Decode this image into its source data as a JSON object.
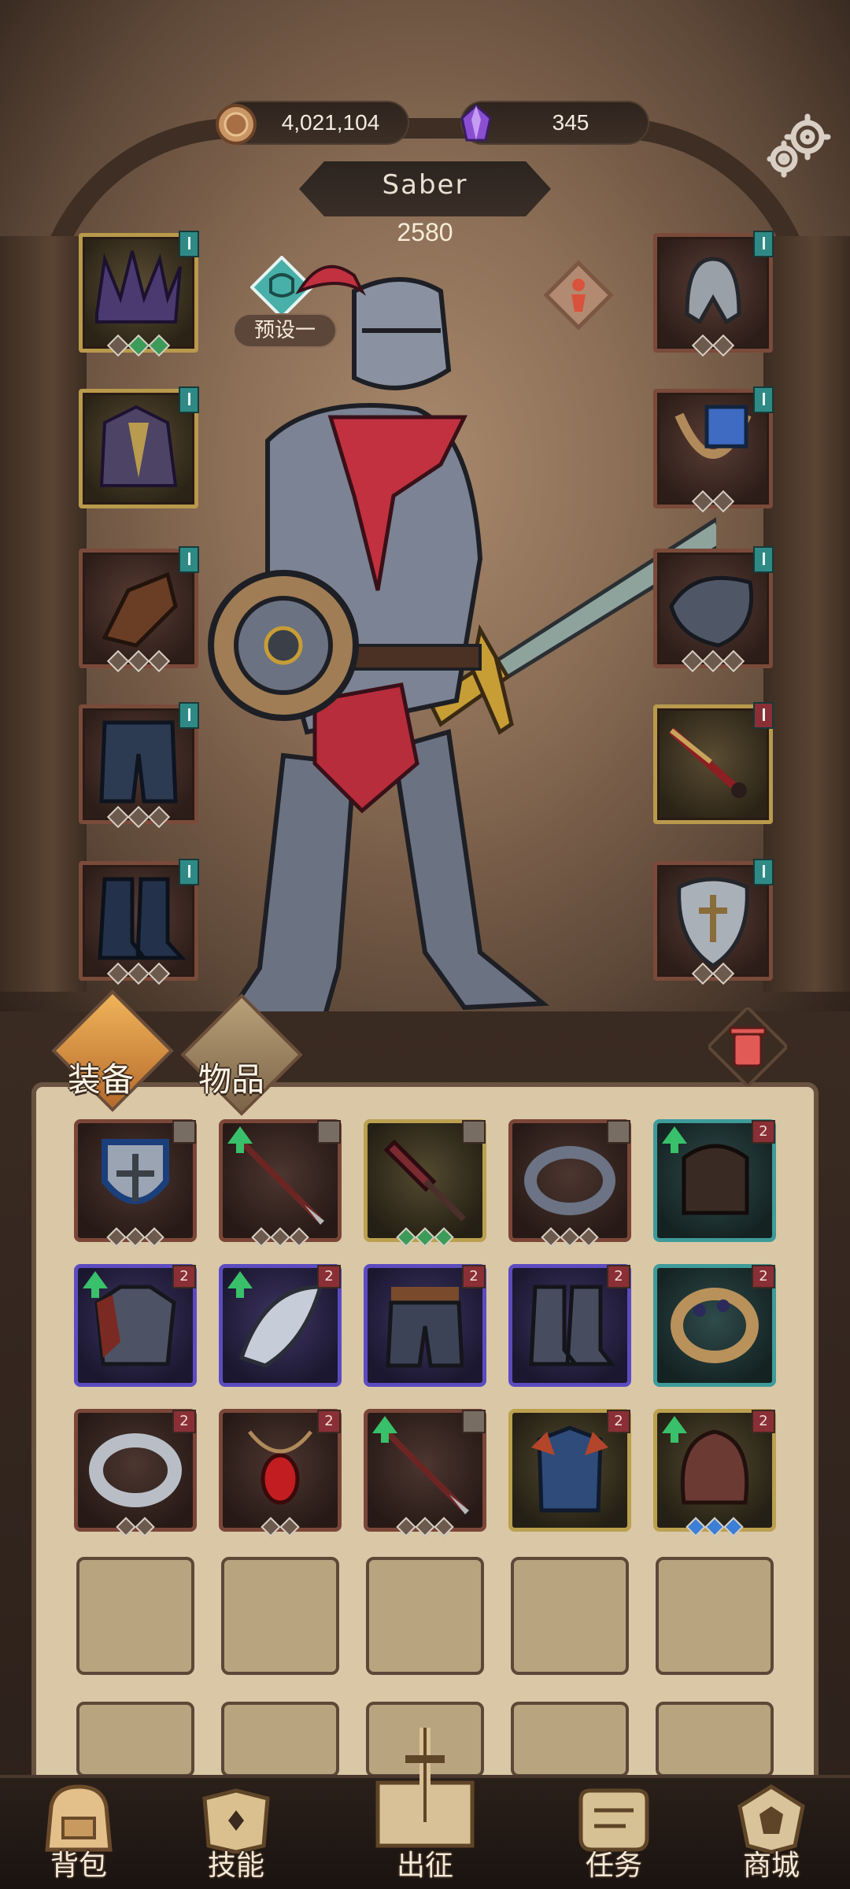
{
  "currency": {
    "coins": "4,021,104",
    "gems": "345"
  },
  "icons": {
    "coin": "coin-icon",
    "gem": "purple-crystal-icon",
    "settings": "gear-icon",
    "trash": "trash-icon"
  },
  "character": {
    "name": "Saber",
    "power": "2580"
  },
  "preset": {
    "label": "预设一"
  },
  "tabs": {
    "equipment": "装备",
    "items": "物品"
  },
  "equipped_left": [
    {
      "name": "crown",
      "rarity": "gold",
      "gems": [
        "grey",
        "green",
        "green"
      ]
    },
    {
      "name": "spiked-armor",
      "rarity": "gold",
      "gems": []
    },
    {
      "name": "leather-gauntlets",
      "rarity": "red",
      "gems": [
        "grey",
        "grey",
        "grey"
      ]
    },
    {
      "name": "chainmail-legs",
      "rarity": "red",
      "gems": [
        "grey",
        "grey",
        "grey"
      ]
    },
    {
      "name": "boots",
      "rarity": "red",
      "gems": [
        "grey",
        "grey",
        "grey"
      ]
    }
  ],
  "equipped_right": [
    {
      "name": "helmet",
      "rarity": "red",
      "gems": [
        "grey",
        "grey"
      ]
    },
    {
      "name": "amulet",
      "rarity": "red",
      "gems": [
        "grey",
        "grey"
      ]
    },
    {
      "name": "pauldron",
      "rarity": "red",
      "gems": [
        "grey",
        "grey",
        "grey"
      ]
    },
    {
      "name": "sword",
      "rarity": "gold",
      "gems": []
    },
    {
      "name": "shield",
      "rarity": "red",
      "gems": [
        "grey",
        "grey"
      ]
    }
  ],
  "inventory": [
    {
      "name": "kite-shield",
      "rarity": "red",
      "badge": "lock",
      "upgrade": false,
      "gems": [
        "grey",
        "grey",
        "grey"
      ]
    },
    {
      "name": "spear",
      "rarity": "red",
      "badge": "lock",
      "upgrade": true,
      "gems": [
        "grey",
        "grey",
        "grey"
      ]
    },
    {
      "name": "spiked-club",
      "rarity": "gold",
      "badge": "lock",
      "upgrade": false,
      "gems": [
        "green",
        "green",
        "green"
      ]
    },
    {
      "name": "ring",
      "rarity": "red",
      "badge": "lock",
      "upgrade": false,
      "gems": [
        "grey",
        "grey",
        "grey"
      ]
    },
    {
      "name": "leather-gloves",
      "rarity": "teal",
      "badge": "2",
      "upgrade": true,
      "gems": []
    },
    {
      "name": "tattered-armor",
      "rarity": "purple",
      "badge": "2",
      "upgrade": true,
      "gems": []
    },
    {
      "name": "winged-pauldron",
      "rarity": "purple",
      "badge": "2",
      "upgrade": true,
      "gems": []
    },
    {
      "name": "belted-pants",
      "rarity": "purple",
      "badge": "2",
      "upgrade": false,
      "gems": []
    },
    {
      "name": "iron-boots",
      "rarity": "purple",
      "badge": "2",
      "upgrade": false,
      "gems": []
    },
    {
      "name": "jeweled-ring",
      "rarity": "teal",
      "badge": "2",
      "upgrade": false,
      "gems": []
    },
    {
      "name": "silver-ring",
      "rarity": "red",
      "badge": "2",
      "upgrade": false,
      "gems": [
        "grey",
        "grey"
      ]
    },
    {
      "name": "ruby-pendant",
      "rarity": "red",
      "badge": "2",
      "upgrade": false,
      "gems": [
        "grey",
        "grey"
      ]
    },
    {
      "name": "lance",
      "rarity": "red",
      "badge": "lock",
      "upgrade": true,
      "gems": [
        "grey",
        "grey",
        "grey"
      ]
    },
    {
      "name": "scarab-armor",
      "rarity": "gold",
      "badge": "2",
      "upgrade": false,
      "gems": []
    },
    {
      "name": "leather-hood",
      "rarity": "gold",
      "badge": "2",
      "upgrade": true,
      "gems": [
        "blue",
        "blue",
        "blue"
      ]
    }
  ],
  "nav": {
    "bag": "背包",
    "skills": "技能",
    "battle": "出征",
    "quests": "任务",
    "shop": "商城"
  },
  "colors": {
    "gold_frame": "#bba04f",
    "red_frame": "#7a4638",
    "purple_frame": "#5c4bc0",
    "teal_frame": "#3e9b9a",
    "upgrade_arrow": "#39c06a"
  }
}
